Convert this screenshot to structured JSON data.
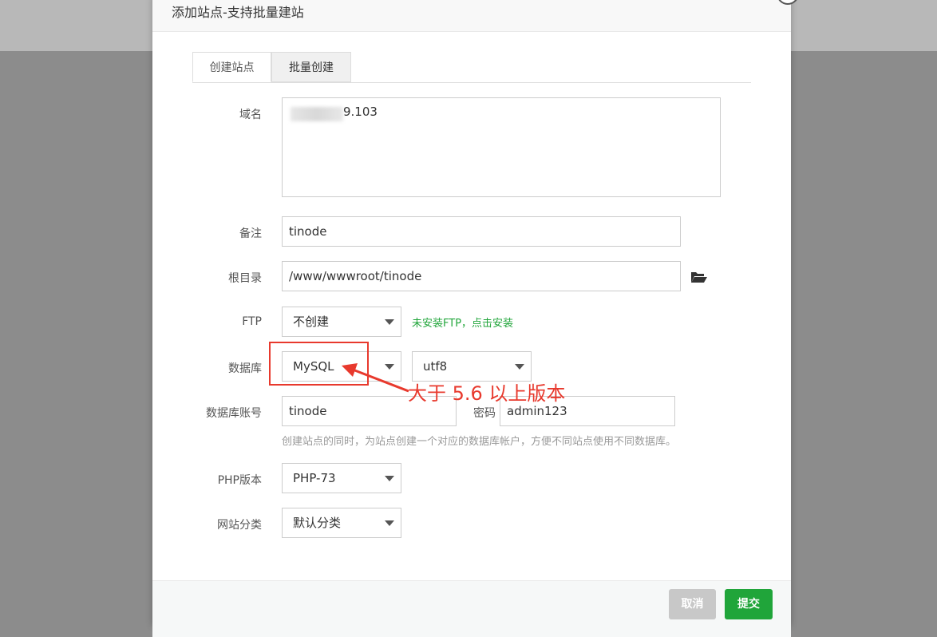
{
  "dialog": {
    "title": "添加站点-支持批量建站"
  },
  "tabs": [
    {
      "label": "创建站点",
      "active": true
    },
    {
      "label": "批量创建",
      "active": false
    }
  ],
  "form": {
    "domain": {
      "label": "域名",
      "value": "9.103"
    },
    "remark": {
      "label": "备注",
      "value": "tinode"
    },
    "root_dir": {
      "label": "根目录",
      "value": "/www/wwwroot/tinode"
    },
    "ftp": {
      "label": "FTP",
      "selected": "不创建",
      "hint": "未安装FTP，点击安装"
    },
    "database": {
      "label": "数据库",
      "type_selected": "MySQL",
      "charset_selected": "utf8"
    },
    "db_account": {
      "label": "数据库账号",
      "user": "tinode",
      "password_label": "密码",
      "password": "admin123",
      "hint": "创建站点的同时，为站点创建一个对应的数据库帐户，方便不同站点使用不同数据库。"
    },
    "php_version": {
      "label": "PHP版本",
      "selected": "PHP-73"
    },
    "category": {
      "label": "网站分类",
      "selected": "默认分类"
    }
  },
  "footer": {
    "cancel_label": "取消",
    "submit_label": "提交"
  },
  "annotation": {
    "text": "大于 5.6 以上版本",
    "color": "#e8392d"
  },
  "colors": {
    "accent_green": "#20a53a",
    "annotation_red": "#e8392d"
  }
}
